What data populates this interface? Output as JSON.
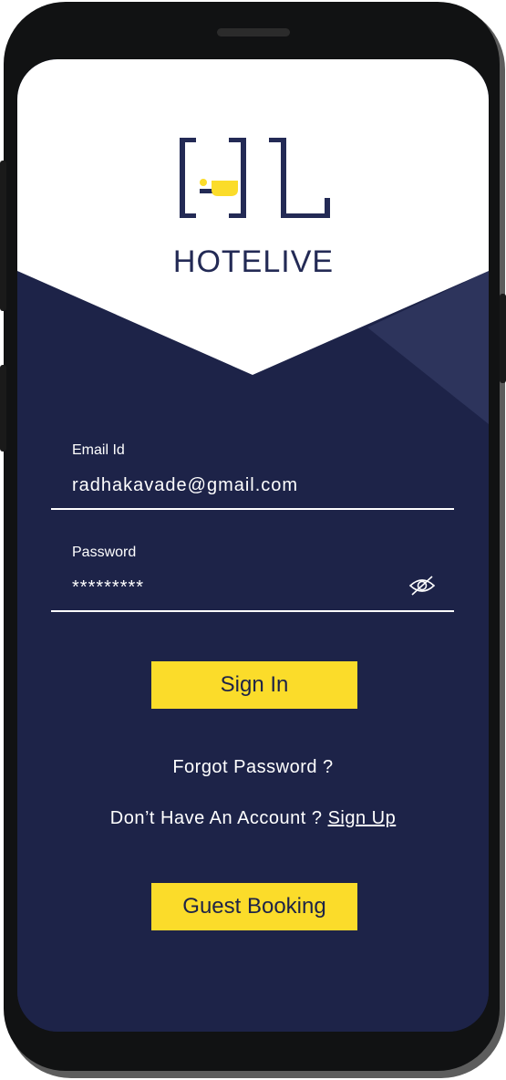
{
  "app": {
    "brand_name": "HOTELIVE"
  },
  "colors": {
    "navy": "#1d2348",
    "accent_yellow": "#fbdc2a",
    "brand_text": "#232a55"
  },
  "login": {
    "email_label": "Email Id",
    "email_value": "radhakavade@gmail.com",
    "password_label": "Password",
    "password_value": "*********",
    "password_toggle_icon": "eye-off-icon",
    "sign_in_label": "Sign In",
    "forgot_password_label": "Forgot Password ?",
    "no_account_text": "Don’t Have An Account ?",
    "sign_up_label": "Sign Up",
    "guest_booking_label": "Guest Booking"
  }
}
